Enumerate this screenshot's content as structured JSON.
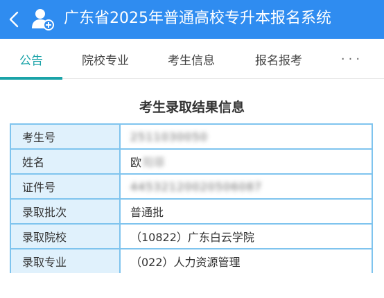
{
  "header": {
    "title": "广东省2025年普通高校专升本报名系统",
    "back_icon": "chevron-left-icon",
    "logo_icon": "user-add-icon",
    "background": "#2f8cf0"
  },
  "tabs": [
    {
      "label": "公告",
      "active": true
    },
    {
      "label": "院校专业",
      "active": false
    },
    {
      "label": "考生信息",
      "active": false
    },
    {
      "label": "报名报考",
      "active": false
    },
    {
      "label": "···",
      "active": false
    }
  ],
  "section_title": "考生录取结果信息",
  "table": {
    "rows": [
      {
        "label": "考生号",
        "value": "2511030050"
      },
      {
        "label": "姓名",
        "value": "欧",
        "value_masked": "阳菲"
      },
      {
        "label": "证件号",
        "value": "44532120020506087"
      },
      {
        "label": "录取批次",
        "value": "普通批"
      },
      {
        "label": "录取院校",
        "value": "（10822）广东白云学院"
      },
      {
        "label": "录取专业",
        "value": "（022）人力资源管理"
      }
    ]
  },
  "colors": {
    "accent": "#1aa3a8",
    "table_border": "#7fc4ee",
    "label_bg": "#e0f1fc"
  }
}
